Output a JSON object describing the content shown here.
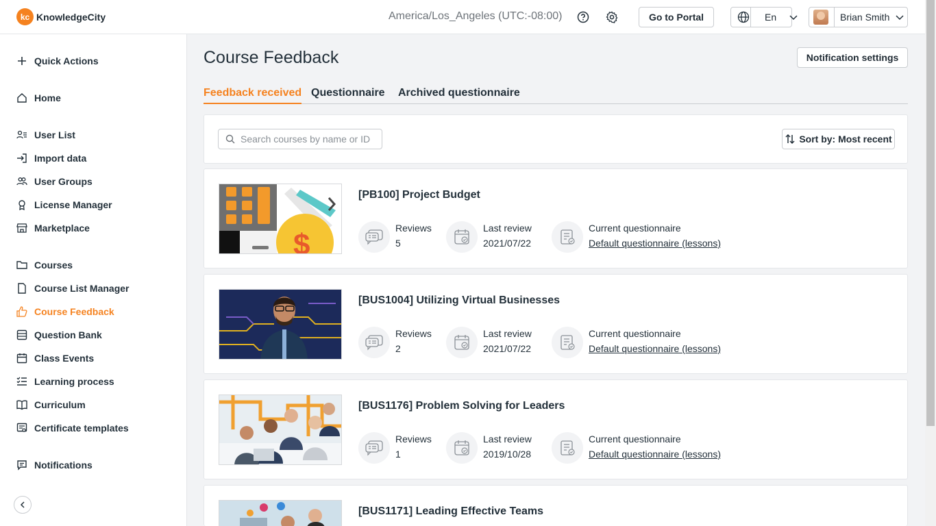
{
  "header": {
    "logo_mark": "kc",
    "logo_text": "KnowledgeCity",
    "timezone": "America/Los_Angeles (UTC:-08:00)",
    "portal_label": "Go to Portal",
    "language": "En",
    "user_name": "Brian Smith"
  },
  "sidebar": {
    "items": [
      {
        "label": "Quick Actions",
        "icon": "plus-icon"
      },
      {
        "label": "Home",
        "icon": "home-icon"
      },
      {
        "label": "User List",
        "icon": "user-list-icon"
      },
      {
        "label": "Import data",
        "icon": "import-icon"
      },
      {
        "label": "User Groups",
        "icon": "user-groups-icon"
      },
      {
        "label": "License Manager",
        "icon": "license-icon"
      },
      {
        "label": "Marketplace",
        "icon": "store-icon"
      },
      {
        "label": "Courses",
        "icon": "folder-icon"
      },
      {
        "label": "Course List Manager",
        "icon": "file-icon"
      },
      {
        "label": "Course Feedback",
        "icon": "thumbs-up-icon",
        "active": true
      },
      {
        "label": "Question Bank",
        "icon": "list-box-icon"
      },
      {
        "label": "Class Events",
        "icon": "calendar-icon"
      },
      {
        "label": "Learning process",
        "icon": "checklist-icon"
      },
      {
        "label": "Curriculum",
        "icon": "book-icon"
      },
      {
        "label": "Certificate templates",
        "icon": "certificate-icon"
      },
      {
        "label": "Notifications",
        "icon": "message-icon"
      }
    ]
  },
  "main": {
    "title": "Course Feedback",
    "notification_settings": "Notification settings",
    "tabs": [
      {
        "label": "Feedback received",
        "active": true
      },
      {
        "label": "Questionnaire"
      },
      {
        "label": "Archived questionnaire"
      }
    ],
    "search_placeholder": "Search courses by name or ID",
    "sort_label": "Sort by: Most recent",
    "stat_labels": {
      "reviews": "Reviews",
      "last_review": "Last review",
      "questionnaire": "Current questionnaire"
    },
    "courses": [
      {
        "title": "[PB100] Project Budget",
        "reviews": "5",
        "last_review": "2021/07/22",
        "questionnaire": "Default questionnaire (lessons)"
      },
      {
        "title": "[BUS1004] Utilizing Virtual Businesses",
        "reviews": "2",
        "last_review": "2021/07/22",
        "questionnaire": "Default questionnaire (lessons)"
      },
      {
        "title": "[BUS1176] Problem Solving for Leaders",
        "reviews": "1",
        "last_review": "2019/10/28",
        "questionnaire": "Default questionnaire (lessons)"
      },
      {
        "title": "[BUS1171] Leading Effective Teams"
      }
    ]
  },
  "colors": {
    "accent": "#f5821f",
    "text": "#23303a"
  }
}
